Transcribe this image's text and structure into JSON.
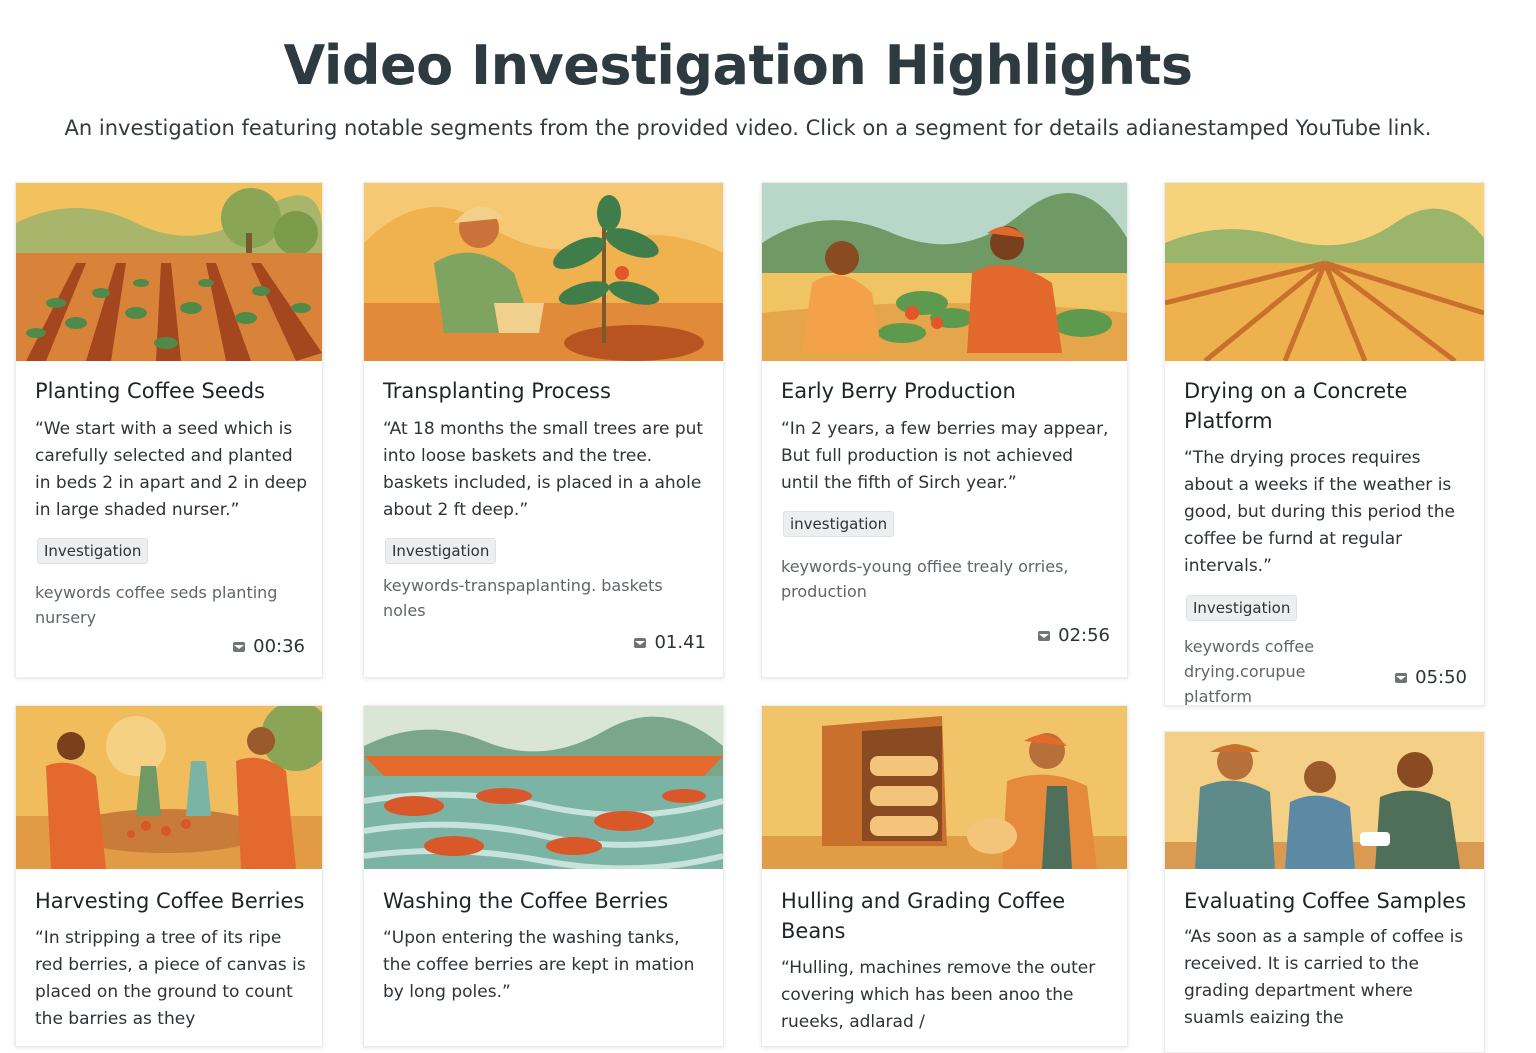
{
  "header": {
    "title": "Video Investigation Highlights",
    "subtitle": "An investigation featuring notable segments from the provided video. Click on a segment for details adianestamped YouTube link."
  },
  "colors": {
    "sand": "#f1b654",
    "orange": "#e06a2e",
    "green": "#6f9a55",
    "teal": "#7bb3a4",
    "brown": "#8a4a22"
  },
  "cards": [
    {
      "title": "Planting Coffee Seeds",
      "quote": "“We start with a seed which is carefully selected and planted in beds 2 in apart and 2 in deep in large shaded nurser.”",
      "tag": "Investigation",
      "keywords": "keywords coffee seds planting nursery",
      "timestamp": "00:36",
      "thumb_icon": "seedling-rows-illustration"
    },
    {
      "title": "Transplanting Process",
      "quote": "“At 18 months the small trees are put into loose baskets and the tree. baskets included, is placed in a ahole about 2 ft deep.”",
      "tag": "Investigation",
      "keywords": "keywords-transpaplanting. baskets noles",
      "timestamp": "01.41",
      "thumb_icon": "farmer-planting-illustration"
    },
    {
      "title": "Early Berry Production",
      "quote": "“In 2 years, a few berries may appear, But full production is not achieved until the fifth of Sirch year.”",
      "tag": "investigation",
      "keywords": "keywords-young offiee trealy orries, production",
      "timestamp": "02:56",
      "thumb_icon": "workers-picking-illustration"
    },
    {
      "title": "Drying on a Concrete Platform",
      "quote": "“The drying proces requires about a weeks if the weather is good, but during this period the coffee be furnd at regular intervals.”",
      "tag": "Investigation",
      "keywords": "keywords coffee   drying.corupue platform",
      "timestamp": "05:50",
      "thumb_icon": "drying-field-illustration"
    },
    {
      "title": "Harvesting Coffee Berries",
      "quote": "“In stripping a tree of its ripe red berries, a piece of canvas is placed on the ground to count the barries as they",
      "tag": "",
      "keywords": "",
      "timestamp": "",
      "thumb_icon": "harvest-canvas-illustration"
    },
    {
      "title": "Washing the Coffee Berries",
      "quote": "“Upon entering the washing tanks, the coffee berries are kept in mation by long poles.”",
      "tag": "",
      "keywords": "",
      "timestamp": "",
      "thumb_icon": "washing-tank-illustration"
    },
    {
      "title": "Hulling and Grading Coffee Beans",
      "quote": "“Hulling, machines remove the outer covering which has been anoo the rueeks, adlarad /",
      "tag": "",
      "keywords": "",
      "timestamp": "",
      "thumb_icon": "hulling-machine-illustration"
    },
    {
      "title": "Evaluating Coffee Samples",
      "quote": "“As soon as a sample of coffee is received. It is carried to the grading department where suamls eaizing the",
      "tag": "",
      "keywords": "",
      "timestamp": "",
      "thumb_icon": "tasting-table-illustration"
    }
  ]
}
